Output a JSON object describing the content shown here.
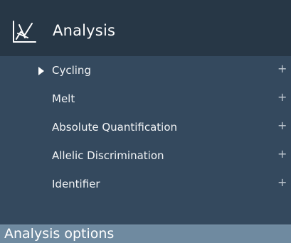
{
  "header": {
    "title": "Analysis",
    "icon": "analysis-chart-icon"
  },
  "items": [
    {
      "label": "Cycling",
      "expand": "+",
      "has_caret": true
    },
    {
      "label": "Melt",
      "expand": "+"
    },
    {
      "label": "Absolute Quantification",
      "expand": "+"
    },
    {
      "label": "Allelic Discrimination",
      "expand": "+"
    },
    {
      "label": "Identifier",
      "expand": "+"
    }
  ],
  "footer": {
    "label": "Analysis options"
  },
  "colors": {
    "panel": "#34495e",
    "header": "#273746",
    "footer": "#6f8aa0"
  }
}
